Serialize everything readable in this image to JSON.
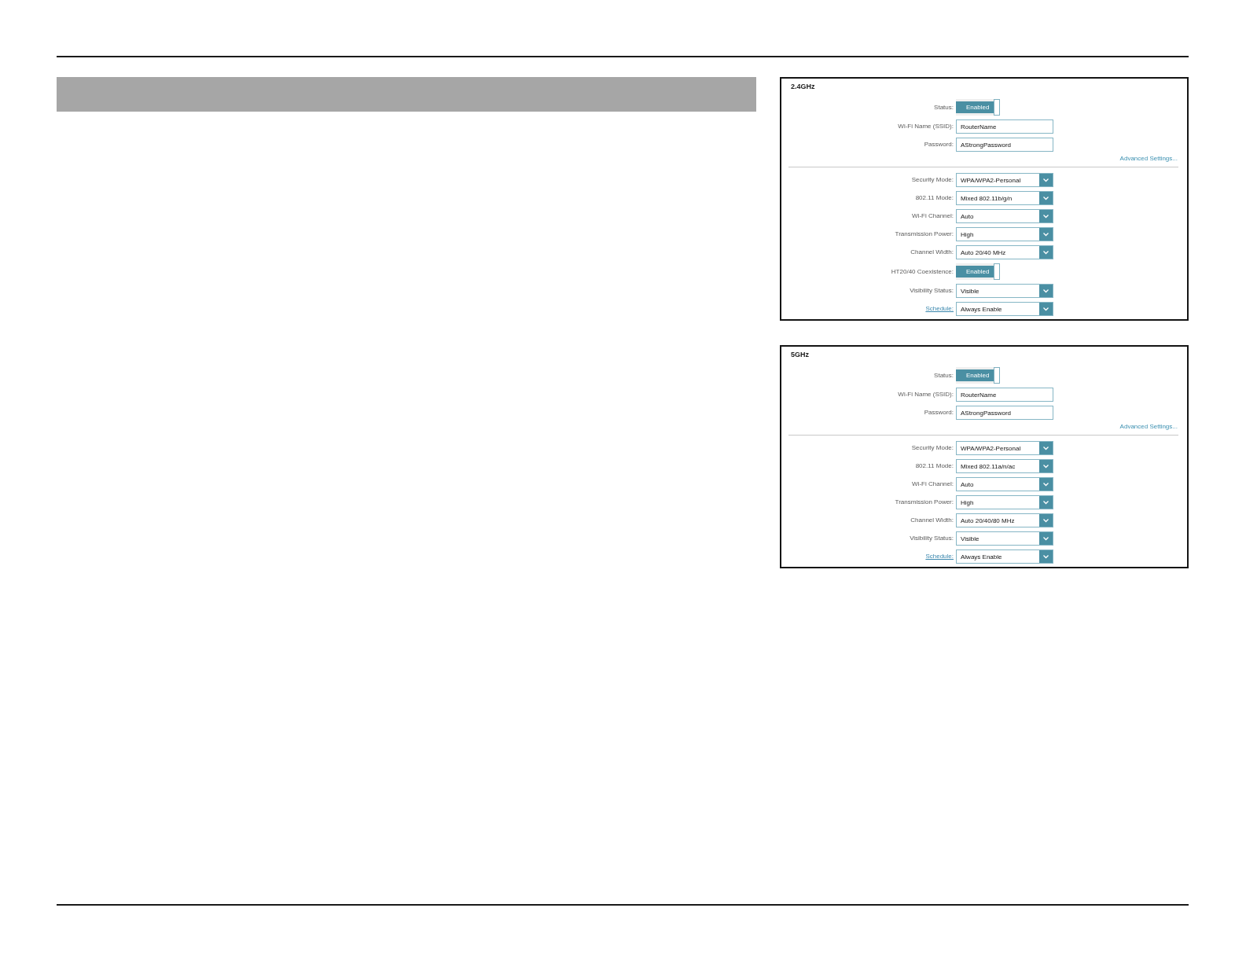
{
  "panels": [
    {
      "title": "2.4GHz",
      "basic_fields": [
        {
          "kind": "toggle",
          "label": "Status:",
          "label_link": false,
          "value": "Enabled",
          "on": true
        },
        {
          "kind": "text",
          "label": "Wi-Fi Name (SSID):",
          "label_link": false,
          "value": "RouterName"
        },
        {
          "kind": "text",
          "label": "Password:",
          "label_link": false,
          "value": "AStrongPassword"
        }
      ],
      "advanced_link": "Advanced Settings...",
      "advanced_fields": [
        {
          "kind": "select",
          "label": "Security Mode:",
          "label_link": false,
          "value": "WPA/WPA2-Personal"
        },
        {
          "kind": "select",
          "label": "802.11 Mode:",
          "label_link": false,
          "value": "Mixed 802.11b/g/n"
        },
        {
          "kind": "select",
          "label": "Wi-Fi Channel:",
          "label_link": false,
          "value": "Auto"
        },
        {
          "kind": "select",
          "label": "Transmission Power:",
          "label_link": false,
          "value": "High"
        },
        {
          "kind": "select",
          "label": "Channel Width:",
          "label_link": false,
          "value": "Auto 20/40 MHz"
        },
        {
          "kind": "toggle",
          "label": "HT20/40 Coexistence:",
          "label_link": false,
          "value": "Enabled",
          "on": true
        },
        {
          "kind": "select",
          "label": "Visibility Status:",
          "label_link": false,
          "value": "Visible"
        },
        {
          "kind": "select",
          "label": "Schedule:",
          "label_link": true,
          "value": "Always Enable"
        }
      ]
    },
    {
      "title": "5GHz",
      "basic_fields": [
        {
          "kind": "toggle",
          "label": "Status:",
          "label_link": false,
          "value": "Enabled",
          "on": true
        },
        {
          "kind": "text",
          "label": "Wi-Fi Name (SSID):",
          "label_link": false,
          "value": "RouterName"
        },
        {
          "kind": "text",
          "label": "Password:",
          "label_link": false,
          "value": "AStrongPassword"
        }
      ],
      "advanced_link": "Advanced Settings...",
      "advanced_fields": [
        {
          "kind": "select",
          "label": "Security Mode:",
          "label_link": false,
          "value": "WPA/WPA2-Personal"
        },
        {
          "kind": "select",
          "label": "802.11 Mode:",
          "label_link": false,
          "value": "Mixed 802.11a/n/ac"
        },
        {
          "kind": "select",
          "label": "Wi-Fi Channel:",
          "label_link": false,
          "value": "Auto"
        },
        {
          "kind": "select",
          "label": "Transmission Power:",
          "label_link": false,
          "value": "High"
        },
        {
          "kind": "select",
          "label": "Channel Width:",
          "label_link": false,
          "value": "Auto 20/40/80 MHz"
        },
        {
          "kind": "select",
          "label": "Visibility Status:",
          "label_link": false,
          "value": "Visible"
        },
        {
          "kind": "select",
          "label": "Schedule:",
          "label_link": true,
          "value": "Always Enable"
        }
      ]
    }
  ]
}
